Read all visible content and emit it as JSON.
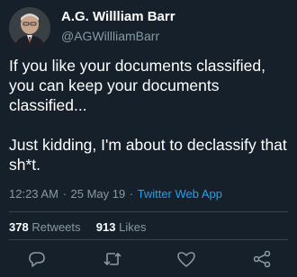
{
  "tweet": {
    "author": {
      "display_name": "A.G. Willliam Barr",
      "handle": "@AGWillliamBarr"
    },
    "text": "If you like your documents classified, you can keep your documents classified...\n\nJust kidding, I'm about to declassify that sh*t.",
    "time": "12:23 AM",
    "separator": "·",
    "date": "25 May 19",
    "source": "Twitter Web App",
    "stats": {
      "retweets_count": "378",
      "retweets_label": "Retweets",
      "likes_count": "913",
      "likes_label": "Likes"
    },
    "actions": [
      {
        "name": "reply",
        "icon": "reply-icon"
      },
      {
        "name": "retweet",
        "icon": "retweet-icon"
      },
      {
        "name": "like",
        "icon": "heart-icon"
      },
      {
        "name": "share",
        "icon": "share-icon"
      }
    ]
  },
  "colors": {
    "background": "#15202b",
    "secondary_text": "#8899a6",
    "link": "#1da1f2",
    "divider": "#38444d"
  }
}
